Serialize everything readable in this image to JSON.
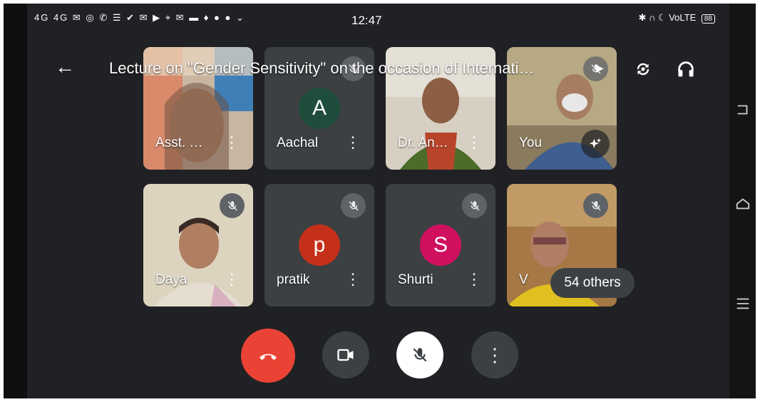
{
  "status": {
    "icons": "4G 4G ✉ ◎ ✆ ☰ ✔ ✉ ▶ ⌖ ✉ ▬ ♦ ● ● ⌄",
    "time": "12:47",
    "right": "✱ ∩ ☾ VoLTE",
    "battery": "88"
  },
  "meeting": {
    "title": "Lecture on \"Gender Sensitivity\" on the occasion of Internati…"
  },
  "participants": [
    {
      "name": "Asst. …"
    },
    {
      "name": "Aachal",
      "initial": "A"
    },
    {
      "name": "Dr. An…"
    },
    {
      "name": "You"
    },
    {
      "name": "Daya"
    },
    {
      "name": "pratik",
      "initial": "p"
    },
    {
      "name": "Shurti",
      "initial": "S"
    },
    {
      "name": "V"
    }
  ],
  "others_label": "54 others",
  "colors": {
    "avatar_a": "#1e4d3c",
    "avatar_p": "#c5301a",
    "avatar_s": "#d0105f",
    "end_call": "#ea4335"
  }
}
